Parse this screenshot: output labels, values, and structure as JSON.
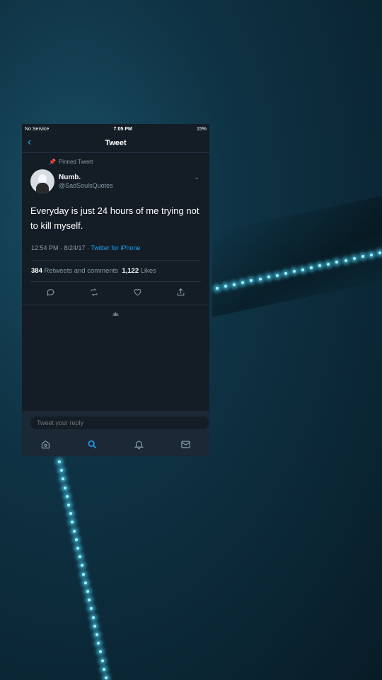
{
  "status_bar": {
    "carrier": "No Service",
    "time": "7:05 PM",
    "battery": "15%"
  },
  "navbar": {
    "title": "Tweet"
  },
  "tweet": {
    "pinned_label": "Pinned Tweet",
    "author_name": "Numb.",
    "author_handle": "@SadSoulsQuotes",
    "text": "Everyday is just 24 hours of me trying not to kill myself.",
    "timestamp": "12:54 PM · 8/24/17 · ",
    "source": "Twitter for iPhone",
    "retweets": "384",
    "retweets_label": "Retweets and comments",
    "likes": "1,122",
    "likes_label": "Likes"
  },
  "reply": {
    "placeholder": "Tweet your reply"
  },
  "tabs": [
    "home-icon",
    "search-icon",
    "notifications-icon",
    "messages-icon"
  ],
  "colors": {
    "accent": "#1da1f2",
    "background": "#141d26",
    "muted": "#8899a6"
  }
}
